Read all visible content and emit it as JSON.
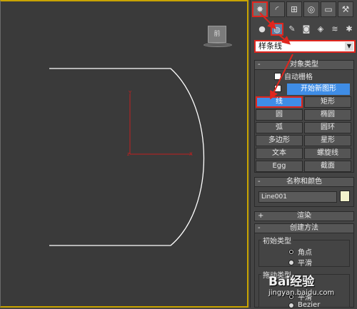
{
  "viewport": {
    "viewcube_label": "前",
    "border_color": "#c8a300",
    "spline_color": "#ffffff",
    "axis_color": "#c02020"
  },
  "panel": {
    "main_tabs": [
      {
        "icon": "create-icon",
        "glyph": "✸",
        "active": true
      },
      {
        "icon": "modify-icon",
        "glyph": "◜",
        "active": false
      },
      {
        "icon": "hierarchy-icon",
        "glyph": "⊞",
        "active": false
      },
      {
        "icon": "motion-icon",
        "glyph": "◎",
        "active": false
      },
      {
        "icon": "display-icon",
        "glyph": "▭",
        "active": false
      },
      {
        "icon": "utilities-icon",
        "glyph": "⚒",
        "active": false
      }
    ],
    "sub_tabs": [
      {
        "icon": "geometry-icon",
        "glyph": "●",
        "active": false
      },
      {
        "icon": "shapes-icon",
        "glyph": "◍",
        "active": true
      },
      {
        "icon": "lights-icon",
        "glyph": "✎",
        "active": false
      },
      {
        "icon": "cameras-icon",
        "glyph": "◙",
        "active": false
      },
      {
        "icon": "helpers-icon",
        "glyph": "◈",
        "active": false
      },
      {
        "icon": "spacewarps-icon",
        "glyph": "≋",
        "active": false
      },
      {
        "icon": "systems-icon",
        "glyph": "✱",
        "active": false
      }
    ],
    "category_dropdown": "样条线",
    "object_type": {
      "title": "对象类型",
      "sign": "-",
      "autogrid_label": "自动栅格",
      "start_new_shape_label": "开始新图形",
      "buttons": [
        [
          "线",
          "矩形"
        ],
        [
          "圆",
          "椭圆"
        ],
        [
          "弧",
          "圆环"
        ],
        [
          "多边形",
          "星形"
        ],
        [
          "文本",
          "螺旋线"
        ],
        [
          "Egg",
          "截面"
        ]
      ],
      "selected": "线"
    },
    "name_color": {
      "title": "名称和颜色",
      "sign": "-",
      "name_value": "Line001",
      "color": "#f2f2cc"
    },
    "rendering": {
      "title": "渲染",
      "sign": "+"
    },
    "creation_method": {
      "title": "创建方法",
      "sign": "-",
      "initial_type_label": "初始类型",
      "initial_options": [
        "角点",
        "平滑"
      ],
      "drag_type_label": "拖动类型",
      "drag_options": [
        "平滑",
        "Bezier"
      ]
    }
  },
  "watermark": {
    "logo": "Bai经验",
    "url": "jingyan.baidu.com"
  }
}
